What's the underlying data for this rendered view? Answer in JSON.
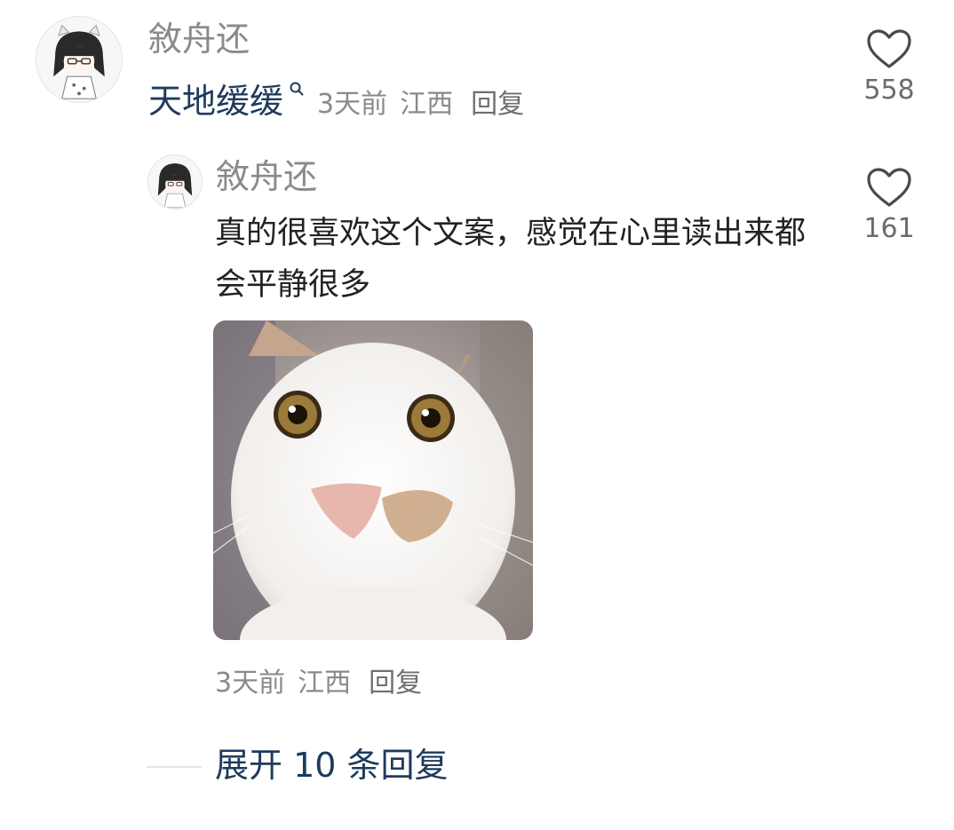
{
  "comment": {
    "author": "敘舟还",
    "mention": "天地缓缓",
    "time": "3天前",
    "location": "江西",
    "reply_label": "回复",
    "like_count": "558"
  },
  "reply": {
    "author": "敘舟还",
    "text": "真的很喜欢这个文案，感觉在心里读出来都会平静很多",
    "time": "3天前",
    "location": "江西",
    "reply_label": "回复",
    "like_count": "161",
    "image_desc": "cat-meme-photo"
  },
  "expand": {
    "label": "展开 10 条回复"
  },
  "colors": {
    "link": "#1e3a5c",
    "muted": "#8a8a8a",
    "text": "#222222"
  }
}
